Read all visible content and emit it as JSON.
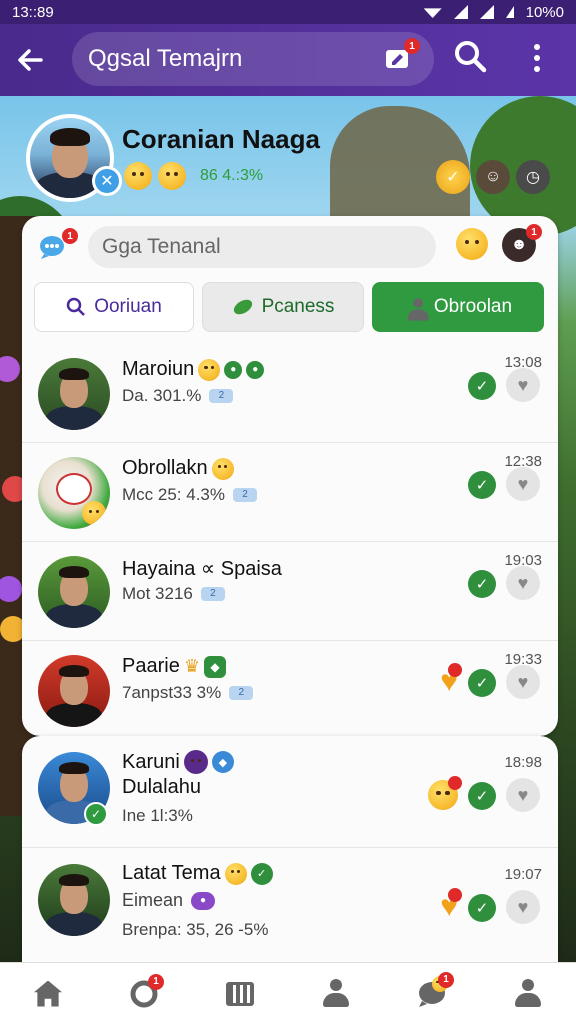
{
  "status_bar": {
    "time": "13::89",
    "battery": "10%0"
  },
  "app_bar": {
    "title": "Qgsal Temajrn",
    "notif_count": "1"
  },
  "profile": {
    "name": "Coranian Naaga",
    "stat": "86 4.:3%"
  },
  "card": {
    "search_placeholder": "Gga Tenanal",
    "chat_notif": "1",
    "avatar_notif": "1",
    "tabs": [
      {
        "label": "Ooriuan",
        "icon": "search-icon"
      },
      {
        "label": "Pcaness",
        "icon": "phone-icon"
      },
      {
        "label": "Obroolan",
        "icon": "person-icon",
        "active": true
      }
    ]
  },
  "chats": [
    {
      "name": "Maroiun",
      "sub": "Da. 301.%",
      "badge": "2",
      "time": "13:08"
    },
    {
      "name": "Obrollakn",
      "sub": "Mcc 25: 4.3%",
      "badge": "2",
      "time": "12:38"
    },
    {
      "name": "Hayaina ∝ Spaisa",
      "sub": "Mot 3216",
      "badge": "2",
      "time": "19:03"
    },
    {
      "name": "Paarie",
      "sub": "7anpst33 3%",
      "badge": "2",
      "time": "19:33"
    }
  ],
  "chats2": [
    {
      "name": "Karuni",
      "name2": "Dulalahu",
      "sub": "Ine 1l:3%",
      "time": "18:98"
    },
    {
      "name": "Latat Tema",
      "name2": "Eimean",
      "sub": "Brenpa: 35, 26 -5%",
      "time": "19:07"
    }
  ],
  "colors": {
    "brand": "#4a2a8c",
    "accent_green": "#2f9a40",
    "notif_red": "#e02a2a"
  },
  "nav": [
    {
      "name": "home-icon"
    },
    {
      "name": "chat-icon",
      "badge": "1"
    },
    {
      "name": "shop-icon"
    },
    {
      "name": "profile-icon"
    },
    {
      "name": "emoji-chat-icon",
      "badge": "1"
    },
    {
      "name": "account-icon"
    }
  ]
}
